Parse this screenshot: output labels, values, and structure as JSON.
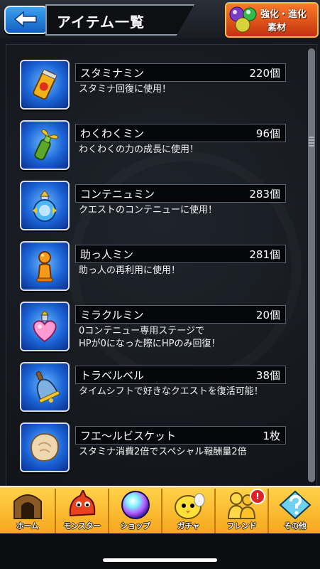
{
  "header": {
    "title": "アイテム一覧",
    "enhance_line1": "強化・進化",
    "enhance_line2": "素材"
  },
  "items": [
    {
      "name": "スタミナミン",
      "count": "220個",
      "desc": [
        "スタミナ回復に使用！"
      ],
      "icon": "stamina-can-icon"
    },
    {
      "name": "わくわくミン",
      "count": "96個",
      "desc": [
        "わくわくの力の成長に使用！"
      ],
      "icon": "sprout-bottle-icon"
    },
    {
      "name": "コンテニュミン",
      "count": "283個",
      "desc": [
        "クエストのコンテニューに使用！"
      ],
      "icon": "continue-potion-icon"
    },
    {
      "name": "助っ人ミン",
      "count": "281個",
      "desc": [
        "助っ人の再利用に使用！"
      ],
      "icon": "helper-pawn-icon"
    },
    {
      "name": "ミラクルミン",
      "count": "20個",
      "desc": [
        "0コンテニュー専用ステージで",
        "HPが0になった際にHPのみ回復！"
      ],
      "icon": "heart-potion-icon"
    },
    {
      "name": "トラベルベル",
      "count": "38個",
      "desc": [
        "タイムシフトで好きなクエストを復活可能！"
      ],
      "icon": "travel-bell-icon"
    },
    {
      "name": "フエ〜ルビスケット",
      "count": "1枚",
      "desc": [
        "スタミナ消費2倍でスペシャル報酬量2倍"
      ],
      "icon": "biscuit-icon"
    }
  ],
  "nav": [
    {
      "label": "ホーム",
      "icon": "home-gate-icon"
    },
    {
      "label": "モンスター",
      "icon": "dragon-icon"
    },
    {
      "label": "ショップ",
      "icon": "orb-icon"
    },
    {
      "label": "ガチャ",
      "icon": "gacha-chick-icon"
    },
    {
      "label": "フレンド",
      "icon": "friends-icon",
      "badge": "!"
    },
    {
      "label": "その他",
      "icon": "other-menu-icon"
    }
  ],
  "colors": {
    "background": "#14171d",
    "nav_yellow": "#f9c02d",
    "back_blue": "#2a86e6",
    "enhance_orange": "#e85a1c",
    "icon_blue": "#1a63d6"
  }
}
